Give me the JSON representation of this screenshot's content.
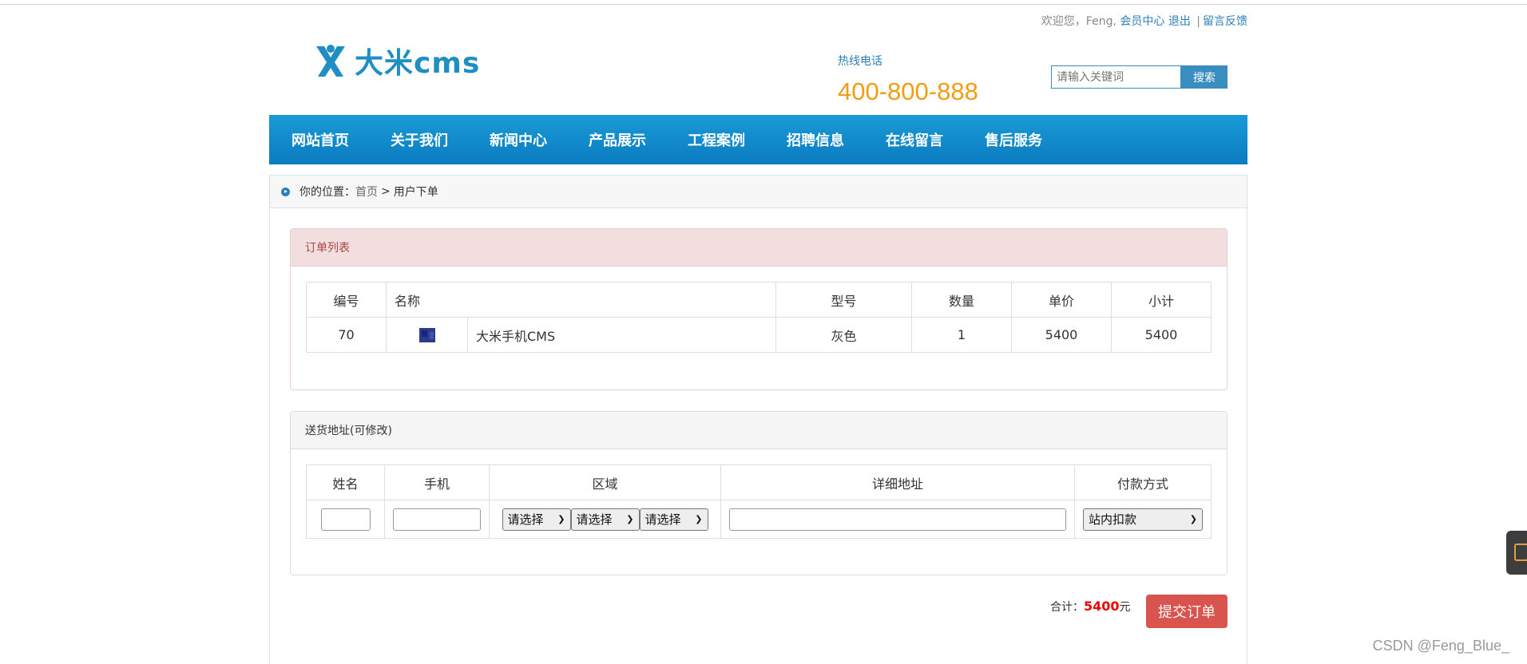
{
  "header": {
    "welcome_text": "欢迎您，Feng,",
    "member_center": "会员中心",
    "logout": "退出",
    "separator": "|",
    "feedback": "留言反馈",
    "logo_text": "大米cms",
    "hotline_label": "热线电话",
    "hotline_number": "400-800-888",
    "search_placeholder": "请输入关键词",
    "search_button": "搜索"
  },
  "nav": {
    "items": [
      "网站首页",
      "关于我们",
      "新闻中心",
      "产品展示",
      "工程案例",
      "招聘信息",
      "在线留言",
      "售后服务"
    ]
  },
  "breadcrumb": {
    "prefix": "你的位置：",
    "home": "首页",
    "arrow": ">",
    "current": "用户下单"
  },
  "order": {
    "title": "订单列表",
    "headers": {
      "id": "编号",
      "name": "名称",
      "model": "型号",
      "qty": "数量",
      "price": "单价",
      "subtotal": "小计"
    },
    "rows": [
      {
        "id": "70",
        "name": "大米手机CMS",
        "model": "灰色",
        "qty": "1",
        "price": "5400",
        "subtotal": "5400"
      }
    ]
  },
  "address": {
    "title": "送货地址(可修改)",
    "headers": {
      "name": "姓名",
      "phone": "手机",
      "region": "区域",
      "detail": "详细地址",
      "payment": "付款方式"
    },
    "region_select_1": "请选择",
    "region_select_2": "请选择",
    "region_select_3": "请选择",
    "payment_select": "站内扣款"
  },
  "summary": {
    "total_label": "合计：",
    "total_value": "5400",
    "currency": "元",
    "submit_button": "提交订单"
  },
  "watermark": "CSDN @Feng_Blue_",
  "colors": {
    "nav_bg": "#0a8ccc",
    "accent_blue": "#2c7fb8",
    "hotline_orange": "#f39c12",
    "danger_red": "#d9534f",
    "order_head_bg": "#f2dede"
  }
}
